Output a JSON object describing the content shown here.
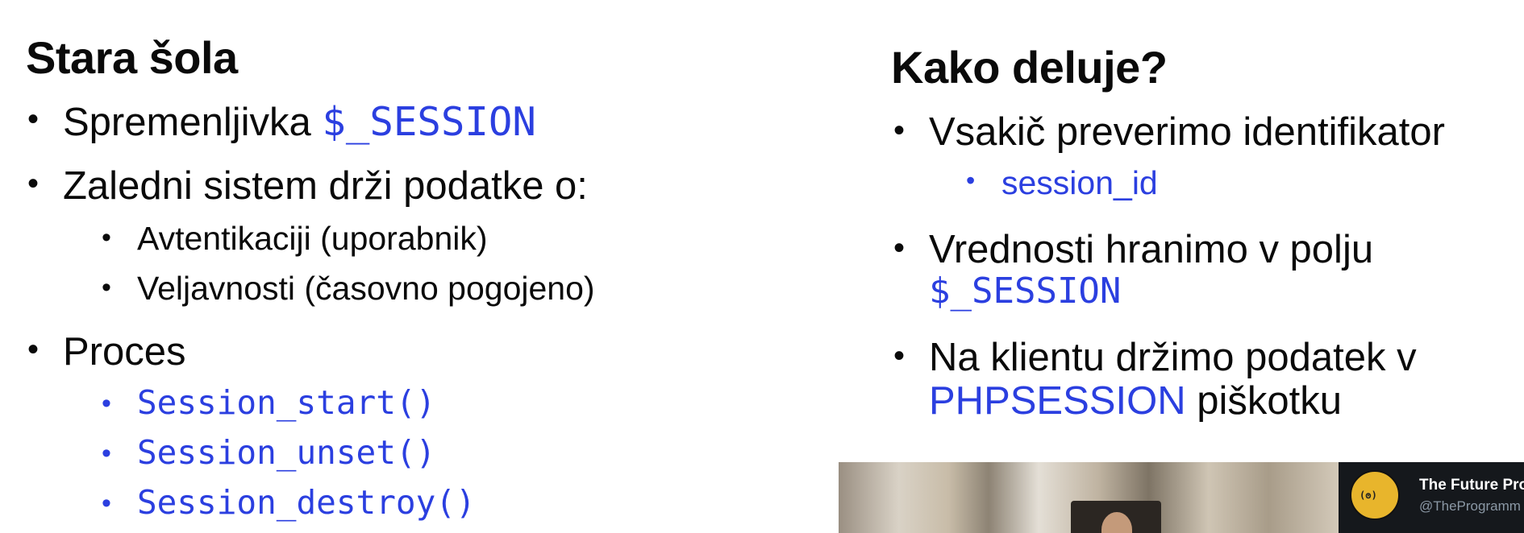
{
  "left": {
    "title": "Stara šola",
    "items": [
      {
        "text": "Spremenljivka ",
        "code": "$_SESSION"
      },
      {
        "text": "Zaledni sistem drži podatke o:",
        "sub": [
          "Avtentikaciji (uporabnik)",
          "Veljavnosti (časovno pogojeno)"
        ]
      },
      {
        "text": "Proces",
        "sub_code": [
          "Session_start()",
          "Session_unset()",
          "Session_destroy()"
        ]
      }
    ]
  },
  "right": {
    "title": "Kako deluje?",
    "items": [
      {
        "text": "Vsakič preverimo identifikator",
        "sub": [
          "session_id"
        ]
      },
      {
        "text": "Vrednosti hranimo v polju",
        "code": "$_SESSION"
      },
      {
        "text_line1": "Na klientu držimo podatek v",
        "highlight": "PHPSESSION",
        "text_line2_rest": " piškotku"
      }
    ]
  },
  "tweet": {
    "name": "The Future Pro",
    "handle": "@TheProgramm",
    "avatar_glyph": "(ꙩ)"
  },
  "colors": {
    "accent": "#2b3fe0",
    "text": "#0a0a0a"
  }
}
